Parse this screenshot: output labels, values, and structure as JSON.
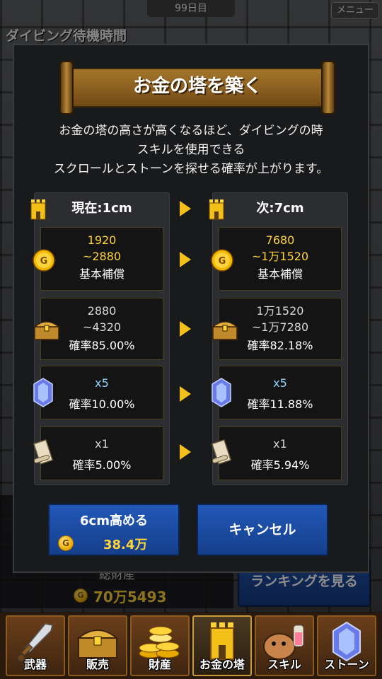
{
  "status": {
    "day": "99日目",
    "menu": "メニュー",
    "dive_title": "ダイビング待機時間"
  },
  "background": {
    "total_label": "総財産",
    "total_value": "70万5493",
    "ranking_button": "ランキングを見る"
  },
  "nav": {
    "items": [
      {
        "label": "武器",
        "icon": "sword-icon",
        "active": false
      },
      {
        "label": "販売",
        "icon": "chest-icon",
        "active": false
      },
      {
        "label": "財産",
        "icon": "coins-icon",
        "active": false
      },
      {
        "label": "お金の塔",
        "icon": "tower-icon",
        "active": true
      },
      {
        "label": "スキル",
        "icon": "pet-icon",
        "active": false
      },
      {
        "label": "ストーン",
        "icon": "stone-icon",
        "active": false
      }
    ]
  },
  "modal": {
    "title": "お金の塔を築く",
    "description": [
      "お金の塔の高さが高くなるほど、ダイビングの時",
      "スキルを使用できる",
      "スクロールとストーンを探せる確率が上がります。"
    ],
    "current": {
      "header": "現在:1cm",
      "reward": {
        "line1": "1920",
        "line2": "~2880",
        "label": "基本補償"
      },
      "chest": {
        "line1": "2880",
        "line2": "~4320",
        "rate": "確率85.00%"
      },
      "stone": {
        "count": "x5",
        "rate": "確率10.00%"
      },
      "scroll": {
        "count": "x1",
        "rate": "確率5.00%"
      }
    },
    "next": {
      "header": "次:7cm",
      "reward": {
        "line1": "7680",
        "line2": "~1万1520",
        "label": "基本補償"
      },
      "chest": {
        "line1": "1万1520",
        "line2": "~1万7280",
        "rate": "確率82.18%"
      },
      "stone": {
        "count": "x5",
        "rate": "確率11.88%"
      },
      "scroll": {
        "count": "x1",
        "rate": "確率5.94%"
      }
    },
    "raise_button": {
      "label": "6cm高める",
      "cost": "38.4万"
    },
    "cancel_button": "キャンセル"
  },
  "colors": {
    "accent_yellow": "#ffd43a",
    "button_blue": "#1d4fa6",
    "stone_blue": "#8fd6ff"
  }
}
